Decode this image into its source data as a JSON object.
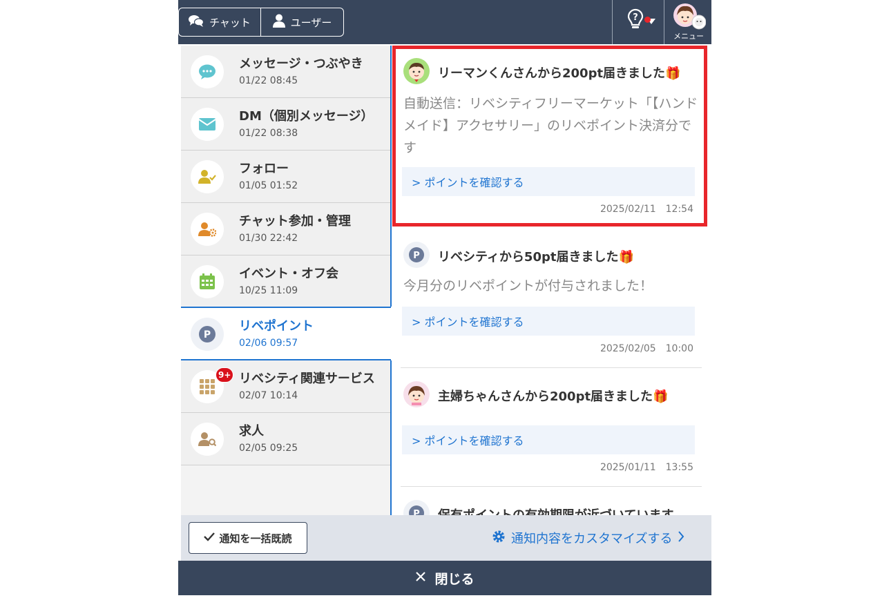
{
  "header": {
    "tab_chat": "チャット",
    "tab_user": "ユーザー",
    "menu_label": "メニュー",
    "help_icon": "question-bulb-icon"
  },
  "sidebar": {
    "items": [
      {
        "label": "メッセージ・つぶやき",
        "time": "01/22 08:45",
        "icon": "chat-bubble-icon",
        "color": "#5fc4cf"
      },
      {
        "label": "DM（個別メッセージ）",
        "time": "01/22 08:38",
        "icon": "envelope-icon",
        "color": "#5fc4cf"
      },
      {
        "label": "フォロー",
        "time": "01/05 01:52",
        "icon": "user-check-icon",
        "color": "#d2b32a"
      },
      {
        "label": "チャット参加・管理",
        "time": "01/30 22:42",
        "icon": "user-gear-icon",
        "color": "#e08a2a"
      },
      {
        "label": "イベント・オフ会",
        "time": "10/25 11:09",
        "icon": "calendar-icon",
        "color": "#7cc24b"
      },
      {
        "label": "リベポイント",
        "time": "02/06 09:57",
        "icon": "point-icon",
        "color": "#6b7a99",
        "active": true
      },
      {
        "label": "リベシティ関連サービス",
        "time": "02/07 10:14",
        "icon": "grid-icon",
        "color": "#c9a46a",
        "badge": "9+"
      },
      {
        "label": "求人",
        "time": "02/05 09:25",
        "icon": "user-search-icon",
        "color": "#b39066"
      }
    ]
  },
  "notifications": [
    {
      "title": "リーマンくんさんから200pt届きました🎁",
      "body": "自動送信：リベシティフリーマーケット「【ハンドメイド】アクセサリー」のリベポイント決済分です",
      "link": "> ポイントを確認する",
      "date": "2025/02/11　12:54",
      "avatar": "salaryman-avatar"
    },
    {
      "title": "リベシティから50pt届きました🎁",
      "body": "今月分のリベポイントが付与されました！",
      "link": "> ポイントを確認する",
      "date": "2025/02/05　10:00",
      "avatar": "point-icon"
    },
    {
      "title": "主婦ちゃんさんから200pt届きました🎁",
      "body": "",
      "link": "> ポイントを確認する",
      "date": "2025/01/11　13:55",
      "avatar": "housewife-avatar"
    },
    {
      "title": "保有ポイントの有効期限が近づいています",
      "avatar": "point-icon"
    }
  ],
  "footer": {
    "mark_all_read": "通知を一括既読",
    "customize": "通知内容をカスタマイズする",
    "close": "閉じる"
  },
  "colors": {
    "header_bg": "#38465c",
    "accent_blue": "#1f74d0",
    "highlight_red": "#e8262b"
  }
}
